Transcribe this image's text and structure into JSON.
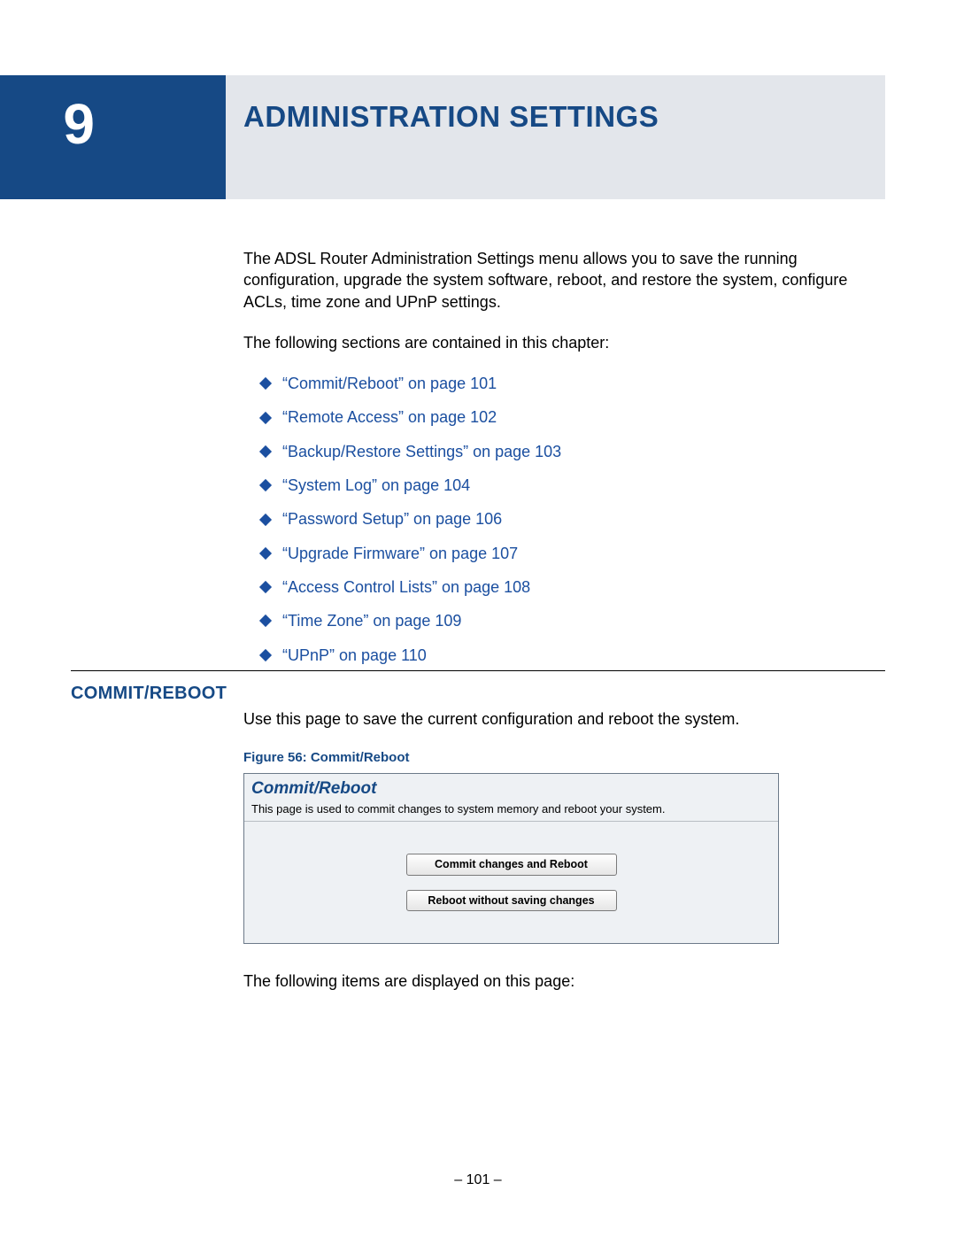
{
  "chapter": {
    "number": "9",
    "title": "ADMINISTRATION SETTINGS"
  },
  "intro": {
    "p1": "The ADSL Router Administration Settings menu allows you to save the running configuration, upgrade the system software, reboot, and restore the system, configure ACLs, time zone and UPnP settings.",
    "p2": "The following sections are contained in this chapter:"
  },
  "toc": [
    "“Commit/Reboot” on page 101",
    "“Remote Access” on page 102",
    "“Backup/Restore Settings” on page 103",
    "“System Log” on page 104",
    "“Password Setup” on page 106",
    "“Upgrade Firmware” on page 107",
    "“Access Control Lists” on page 108",
    "“Time Zone” on page 109",
    "“UPnP” on page 110"
  ],
  "section": {
    "heading": "COMMIT/REBOOT",
    "body": "Use this page to save the current configuration and reboot the system.",
    "figure_caption": "Figure 56:  Commit/Reboot",
    "figure": {
      "title": "Commit/Reboot",
      "desc": "This page is used to commit changes to system memory and reboot your system.",
      "btn1": "Commit changes and Reboot",
      "btn2": "Reboot without saving changes"
    },
    "after_figure": "The following items are displayed on this page:"
  },
  "footer": "–  101  –"
}
